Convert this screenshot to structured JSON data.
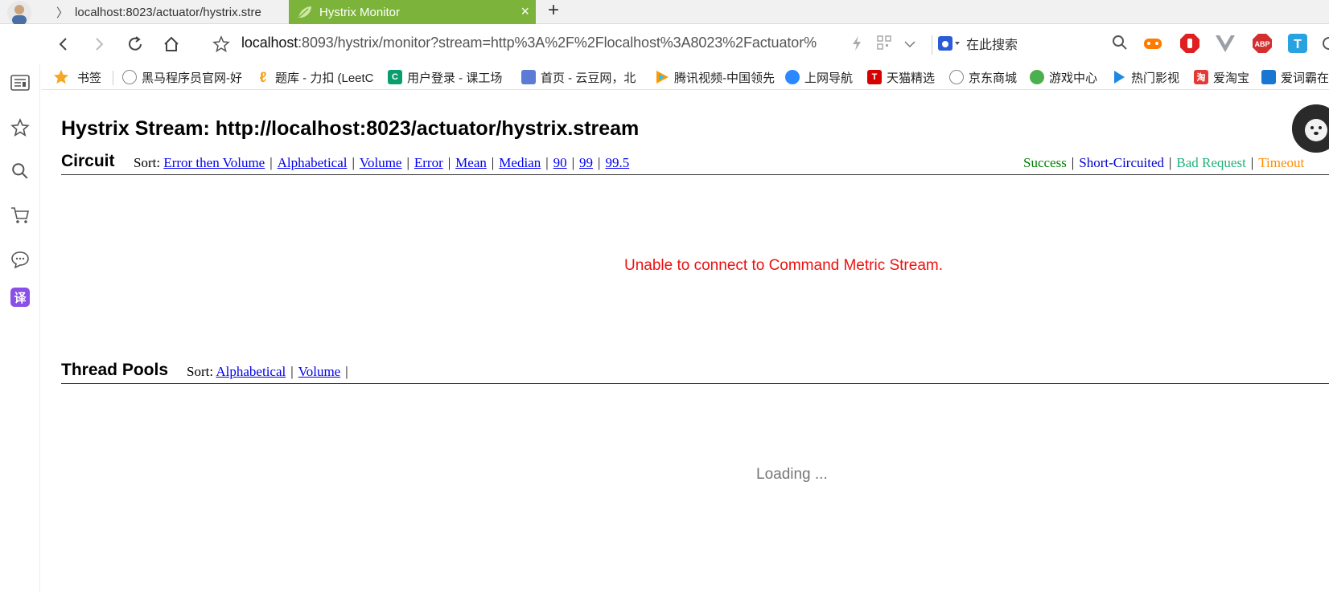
{
  "tabs": [
    {
      "label": "localhost:8023/actuator/hystrix.stre",
      "active": false,
      "prefix": "〉"
    },
    {
      "label": "Hystrix Monitor",
      "active": true
    }
  ],
  "newtab_label": "+",
  "close_label": "×",
  "address": {
    "host": "localhost",
    "rest": ":8093/hystrix/monitor?stream=http%3A%2F%2Flocalhost%3A8023%2Factuator%"
  },
  "search": {
    "text": "在此搜索"
  },
  "bookmarks": [
    {
      "label": "书签",
      "icon": "star-icon",
      "color": "#f5a623"
    },
    {
      "label": "黑马程序员官网-好",
      "icon": "globe-icon",
      "color": "#888888"
    },
    {
      "label": "题库 - 力扣 (LeetC",
      "icon": "leetcode-icon",
      "color": "#f89f1b"
    },
    {
      "label": "用户登录 - 课工场",
      "icon": "kgc-icon",
      "color": "#0a9e6e"
    },
    {
      "label": "首页 - 云豆网，北",
      "icon": "yundou-icon",
      "color": "#5b7bd5"
    },
    {
      "label": "腾讯视频-中国领先",
      "icon": "tencent-video-icon",
      "color": "#ff9a00"
    },
    {
      "label": "上网导航",
      "icon": "nav-icon",
      "color": "#2b88ff"
    },
    {
      "label": "天猫精选",
      "icon": "tmall-icon",
      "color": "#d60000"
    },
    {
      "label": "京东商城",
      "icon": "globe-icon",
      "color": "#888888"
    },
    {
      "label": "游戏中心",
      "icon": "game-icon",
      "color": "#4caf50"
    },
    {
      "label": "热门影视",
      "icon": "video-icon",
      "color": "#1e88e5"
    },
    {
      "label": "爱淘宝",
      "icon": "taobao-icon",
      "color": "#e53935"
    },
    {
      "label": "爱词霸在",
      "icon": "iciba-icon",
      "color": "#1976d2"
    }
  ],
  "page": {
    "title": "Hystrix Stream: http://localhost:8023/actuator/hystrix.stream",
    "circuit": {
      "heading": "Circuit",
      "sort_prefix": "Sort:",
      "sort_options": [
        "Error then Volume",
        "Alphabetical",
        "Volume",
        "Error",
        "Mean",
        "Median",
        "90",
        "99",
        "99.5"
      ],
      "legend": [
        {
          "label": "Success",
          "color": "#008000"
        },
        {
          "label": "Short-Circuited",
          "color": "#0000cc"
        },
        {
          "label": "Bad Request",
          "color": "#20b27a"
        },
        {
          "label": "Timeout",
          "color": "#ff8c00"
        }
      ],
      "message": "Unable to connect to Command Metric Stream."
    },
    "thread_pools": {
      "heading": "Thread Pools",
      "sort_prefix": "Sort:",
      "sort_options": [
        "Alphabetical",
        "Volume"
      ],
      "message": "Loading ..."
    }
  },
  "extensions": [
    {
      "name": "game-extension-icon",
      "color": "#ff7a00"
    },
    {
      "name": "adblock-icon",
      "color": "#e02020"
    },
    {
      "name": "vue-devtools-icon",
      "color": "#9aa0a6"
    },
    {
      "name": "abp-icon",
      "color": "#d32f2f",
      "text": "ABP"
    },
    {
      "name": "translate-extension-icon",
      "color": "#29a3e0",
      "text": "T"
    }
  ],
  "sidebar": [
    "news-icon",
    "star-icon",
    "search-icon",
    "cart-icon",
    "chat-icon",
    "translate-icon"
  ],
  "translate_glyph": "译"
}
